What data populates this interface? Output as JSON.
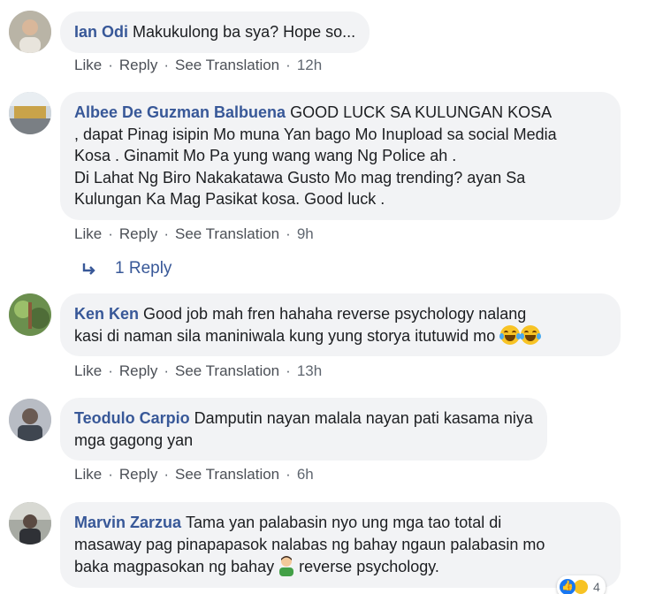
{
  "actions": {
    "like": "Like",
    "reply": "Reply",
    "see_translation": "See Translation",
    "separator": "·"
  },
  "comments": [
    {
      "author": "Ian Odi",
      "lines": [
        "Makukulong ba sya? Hope so..."
      ],
      "time": "12h"
    },
    {
      "author": "Albee De Guzman Balbuena",
      "lines": [
        "GOOD LUCK SA KULUNGAN KOSA",
        ", dapat Pinag isipin Mo muna Yan bago Mo Inupload sa social Media",
        "Kosa . Ginamit Mo Pa yung wang wang Ng Police ah .",
        "Di Lahat Ng Biro Nakakatawa Gusto Mo mag trending? ayan Sa",
        "Kulungan Ka Mag Pasikat kosa. Good luck ."
      ],
      "time": "9h",
      "replies_label": "1 Reply"
    },
    {
      "author": "Ken Ken",
      "lines": [
        "Good job mah fren hahaha reverse psychology nalang",
        "kasi di naman sila maniniwala kung yung storya itutuwid mo"
      ],
      "time": "13h"
    },
    {
      "author": "Teodulo Carpio",
      "lines": [
        "Damputin nayan malala nayan pati kasama niya",
        "mga gagong yan"
      ],
      "time": "6h"
    },
    {
      "author": "Marvin Zarzua",
      "lines": [
        "Tama yan palabasin nyo ung mga tao total di",
        "masaway pag pinapapasok nalabas ng bahay ngaun palabasin mo",
        "baka magpasokan ng bahay",
        "reverse psychology."
      ],
      "reaction_count": "4"
    }
  ],
  "icons": {
    "reply_arrow": "reply-arrow-icon",
    "laughing_emoji": "laughing-crying-emoji-icon",
    "person_emoji": "person-emoji-icon",
    "like_reaction": "like-reaction-icon",
    "haha_reaction": "haha-reaction-icon"
  },
  "colors": {
    "author": "#385898",
    "bubble": "#f2f3f5",
    "action": "#606770"
  }
}
